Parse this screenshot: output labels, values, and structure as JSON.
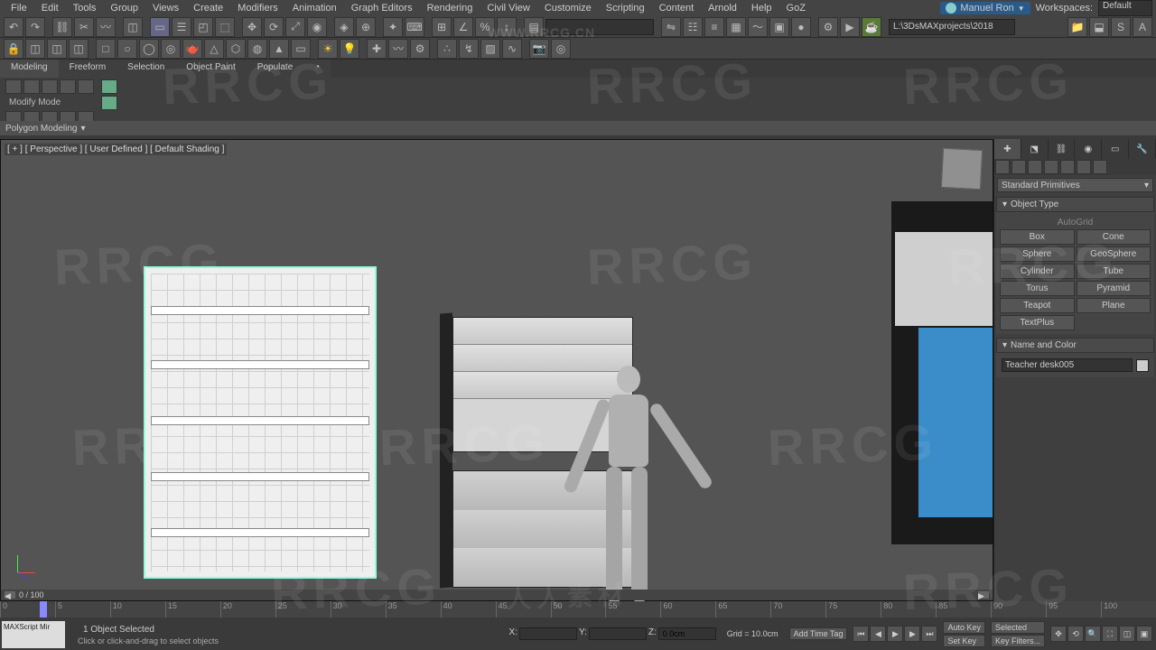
{
  "menu": {
    "items": [
      "File",
      "Edit",
      "Tools",
      "Group",
      "Views",
      "Create",
      "Modifiers",
      "Animation",
      "Graph Editors",
      "Rendering",
      "Civil View",
      "Customize",
      "Scripting",
      "Content",
      "Arnold",
      "Help",
      "GoZ"
    ],
    "user": "Manuel Ron",
    "workspaces_label": "Workspaces:",
    "workspace": "Default"
  },
  "toolbar2": {
    "project_path": "L:\\3DsMAXprojects\\2018"
  },
  "ribbon": {
    "tabs": [
      "Modeling",
      "Freeform",
      "Selection",
      "Object Paint",
      "Populate"
    ],
    "modify_mode": "Modify Mode",
    "polygon_modeling": "Polygon Modeling"
  },
  "viewport": {
    "label": "[ + ] [ Perspective ] [ User Defined ] [ Default Shading ]",
    "frame_display": "0 / 100"
  },
  "command_panel": {
    "category": "Standard Primitives",
    "object_type_header": "Object Type",
    "autogrid": "AutoGrid",
    "primitives": [
      "Box",
      "Cone",
      "Sphere",
      "GeoSphere",
      "Cylinder",
      "Tube",
      "Torus",
      "Pyramid",
      "Teapot",
      "Plane",
      "TextPlus",
      ""
    ],
    "name_color_header": "Name and Color",
    "object_name": "Teacher desk005"
  },
  "timeline": {
    "ticks": [
      "0",
      "5",
      "10",
      "15",
      "20",
      "25",
      "30",
      "35",
      "40",
      "45",
      "50",
      "55",
      "60",
      "65",
      "70",
      "75",
      "80",
      "85",
      "90",
      "95",
      "100"
    ]
  },
  "status": {
    "selection": "1 Object Selected",
    "prompt": "Click or click-and-drag to select objects",
    "maxscript": "MAXScript Mir",
    "x_label": "X:",
    "y_label": "Y:",
    "z_label": "Z:",
    "z_value": "0.0cm",
    "grid": "Grid = 10.0cm",
    "add_time_tag": "Add Time Tag",
    "autokey": "Auto Key",
    "selected_filter": "Selected",
    "setkey": "Set Key",
    "keyfilters": "Key Filters..."
  },
  "watermark": {
    "url": "WWW.RRCG.CN",
    "text": "RRCG",
    "cn": "人人素材"
  }
}
